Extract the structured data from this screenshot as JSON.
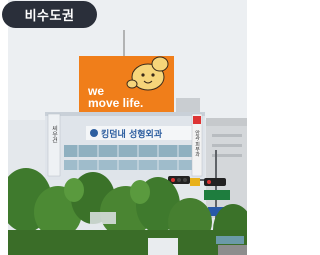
{
  "location_chip": {
    "label": "비수도권"
  },
  "photo": {
    "billboard": {
      "line1": "we",
      "line2": "move life."
    },
    "building": {
      "sign_main": "킹덤내 성형외과",
      "vertical_sign": "씨우건",
      "side_sign": "안과·피부과"
    },
    "colors": {
      "sky": "#e4e8ec",
      "billboard": "#f07e1a",
      "building": "#dfe4ea",
      "glass": "#8fb0c0",
      "trees": "#3f7a2d"
    }
  }
}
